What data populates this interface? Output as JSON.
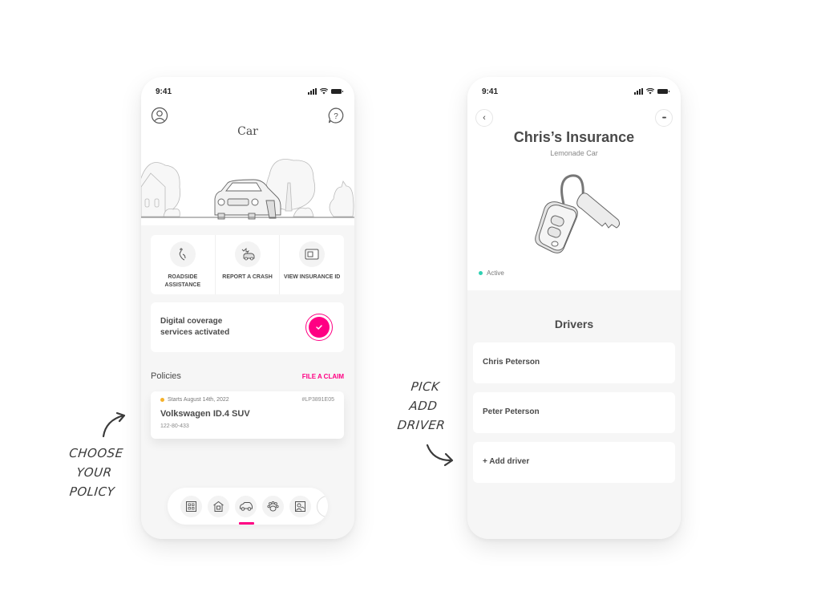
{
  "left_screen": {
    "status_time": "9:41",
    "title": "Car",
    "actions": [
      {
        "icon": "roadside-assistance-icon",
        "label": "Roadside Assistance"
      },
      {
        "icon": "report-crash-icon",
        "label": "Report a Crash"
      },
      {
        "icon": "insurance-id-icon",
        "label": "View Insurance ID"
      }
    ],
    "coverage": {
      "text": "Digital coverage services activated",
      "status_icon": "check-icon"
    },
    "policies": {
      "title": "Policies",
      "file_claim_label": "FILE A CLAIM",
      "items": [
        {
          "status_text": "Starts August 14th, 2022",
          "status_color": "#f5b12a",
          "id": "#LP3891E05",
          "name": "Volkswagen ID.4 SUV",
          "number": "122-80-433"
        }
      ]
    },
    "bottom_nav": [
      {
        "icon": "renters-building-icon",
        "active": false
      },
      {
        "icon": "home-icon",
        "active": false
      },
      {
        "icon": "car-icon",
        "active": true
      },
      {
        "icon": "pet-paw-icon",
        "active": false
      },
      {
        "icon": "life-photo-icon",
        "active": false
      },
      {
        "icon": "more-partial-icon",
        "active": false
      }
    ]
  },
  "right_screen": {
    "status_time": "9:41",
    "back_icon": "chevron-left-icon",
    "more_icon": "more-dots-icon",
    "more_label": "•••",
    "back_label": "‹",
    "title": "Chris’s Insurance",
    "subtitle": "Lemonade Car",
    "status": {
      "label": "Active",
      "color": "#2fd1b3"
    },
    "drivers_title": "Drivers",
    "drivers": [
      {
        "name": "Chris Peterson"
      },
      {
        "name": "Peter Peterson"
      }
    ],
    "add_driver_label": "+ Add driver"
  },
  "annotations": {
    "left_note": [
      "CHOOSE",
      "YOUR",
      "POLICY"
    ],
    "right_note": [
      "PICK",
      "ADD",
      "DRIVER"
    ]
  },
  "colors": {
    "accent": "#ff0083",
    "active_status": "#2fd1b3",
    "pending_status": "#f5b12a",
    "screen_bg": "#f6f6f6"
  }
}
